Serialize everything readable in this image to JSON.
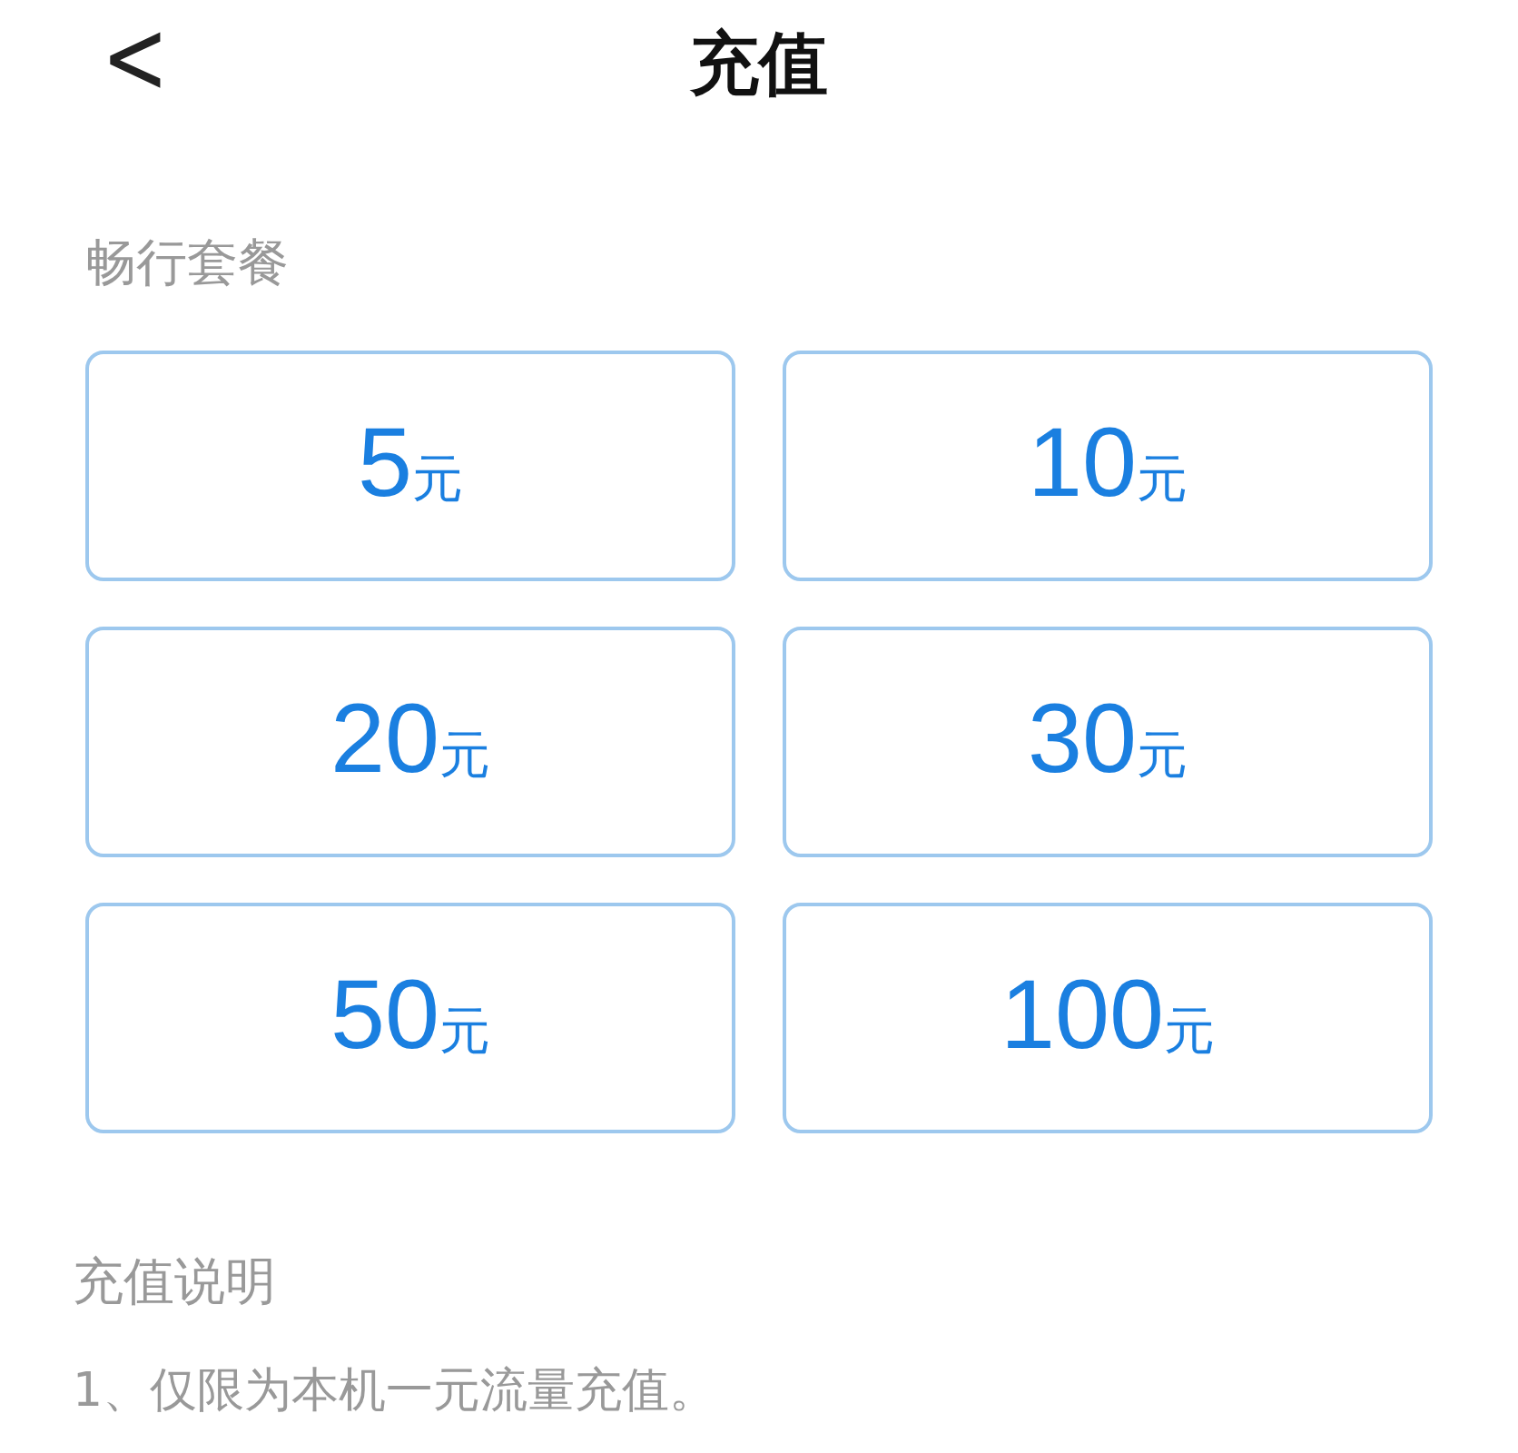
{
  "header": {
    "back": "<",
    "title": "充值"
  },
  "section_label": "畅行套餐",
  "options": [
    {
      "amount": "5",
      "unit": "元"
    },
    {
      "amount": "10",
      "unit": "元"
    },
    {
      "amount": "20",
      "unit": "元"
    },
    {
      "amount": "30",
      "unit": "元"
    },
    {
      "amount": "50",
      "unit": "元"
    },
    {
      "amount": "100",
      "unit": "元"
    }
  ],
  "notes": {
    "title": "充值说明",
    "lines": [
      "1、仅限为本机一元流量充值。"
    ]
  }
}
